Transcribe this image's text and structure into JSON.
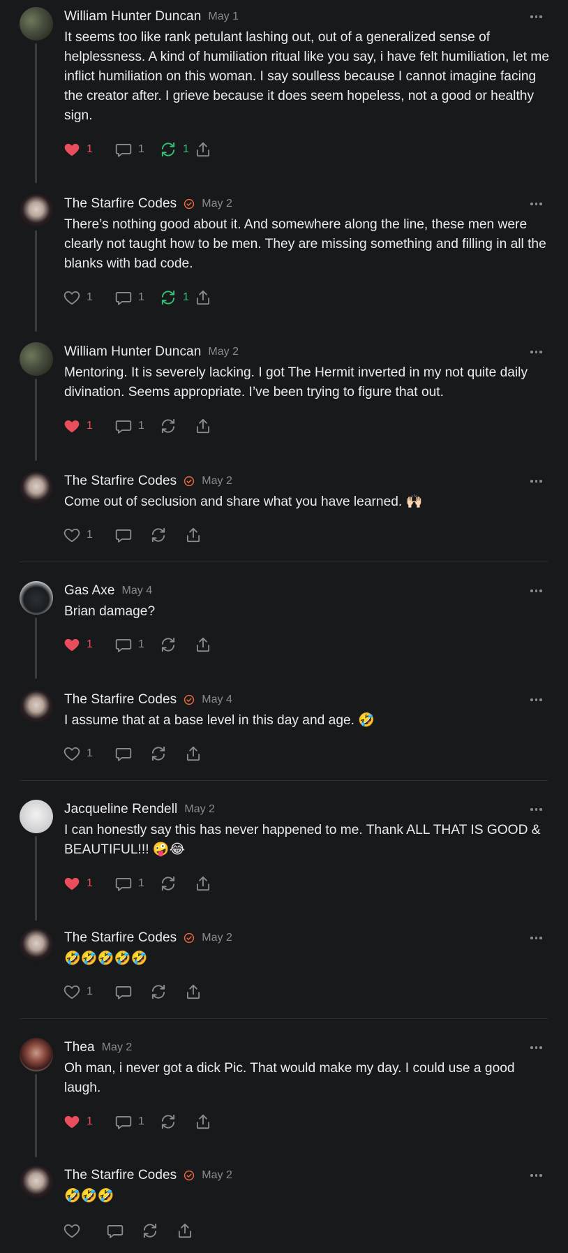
{
  "colors": {
    "background": "#18191b",
    "like": "#ea4d5c",
    "restack": "#35c07a",
    "verified": "#e9673a",
    "muted": "#8a8b90"
  },
  "comments": [
    {
      "author": "William Hunter Duncan",
      "date": "May 1",
      "verified": false,
      "text": "It seems too like rank petulant lashing out, out of a generalized sense of helplessness. A kind of humiliation ritual like you say, i have felt humiliation, let me inflict humiliation on this woman. I say soulless because I cannot imagine facing the creator after. I grieve because it does seem hopeless, not a good or healthy sign.",
      "likes": "1",
      "replies": "1",
      "restacks": "1",
      "liked": true
    },
    {
      "author": "The Starfire Codes",
      "date": "May 2",
      "verified": true,
      "text": "There’s nothing good about it. And somewhere along the line, these men were clearly not taught how to be men. They are missing something and filling in all the blanks with bad code.",
      "likes": "1",
      "replies": "1",
      "restacks": "1",
      "liked": false
    },
    {
      "author": "William Hunter Duncan",
      "date": "May 2",
      "verified": false,
      "text": "Mentoring. It is severely lacking. I got The Hermit inverted in my not quite daily divination. Seems appropriate. I’ve been trying to figure that out.",
      "likes": "1",
      "replies": "1",
      "restacks": "",
      "liked": true
    },
    {
      "author": "The Starfire Codes",
      "date": "May 2",
      "verified": true,
      "text": "Come out of seclusion and share what you have learned. 🙌🏻",
      "likes": "1",
      "replies": "",
      "restacks": "",
      "liked": false
    },
    {
      "author": "Gas Axe",
      "date": "May 4",
      "verified": false,
      "text": "Brian damage?",
      "likes": "1",
      "replies": "1",
      "restacks": "",
      "liked": true
    },
    {
      "author": "The Starfire Codes",
      "date": "May 4",
      "verified": true,
      "text": "I assume that at a base level in this day and age. 🤣",
      "likes": "1",
      "replies": "",
      "restacks": "",
      "liked": false
    },
    {
      "author": "Jacqueline Rendell",
      "date": "May 2",
      "verified": false,
      "text": "I can honestly say this has never happened to me. Thank ALL THAT IS GOOD & BEAUTIFUL!!! 🤪😂",
      "likes": "1",
      "replies": "1",
      "restacks": "",
      "liked": true
    },
    {
      "author": "The Starfire Codes",
      "date": "May 2",
      "verified": true,
      "text": "🤣🤣🤣🤣🤣",
      "likes": "1",
      "replies": "",
      "restacks": "",
      "liked": false
    },
    {
      "author": "Thea",
      "date": "May 2",
      "verified": false,
      "text": "Oh man, i never got a dick Pic. That would make my day. I could use a good laugh.",
      "likes": "1",
      "replies": "1",
      "restacks": "",
      "liked": true
    },
    {
      "author": "The Starfire Codes",
      "date": "May 2",
      "verified": true,
      "text": "🤣🤣🤣",
      "likes": "",
      "replies": "",
      "restacks": "",
      "liked": false
    }
  ]
}
